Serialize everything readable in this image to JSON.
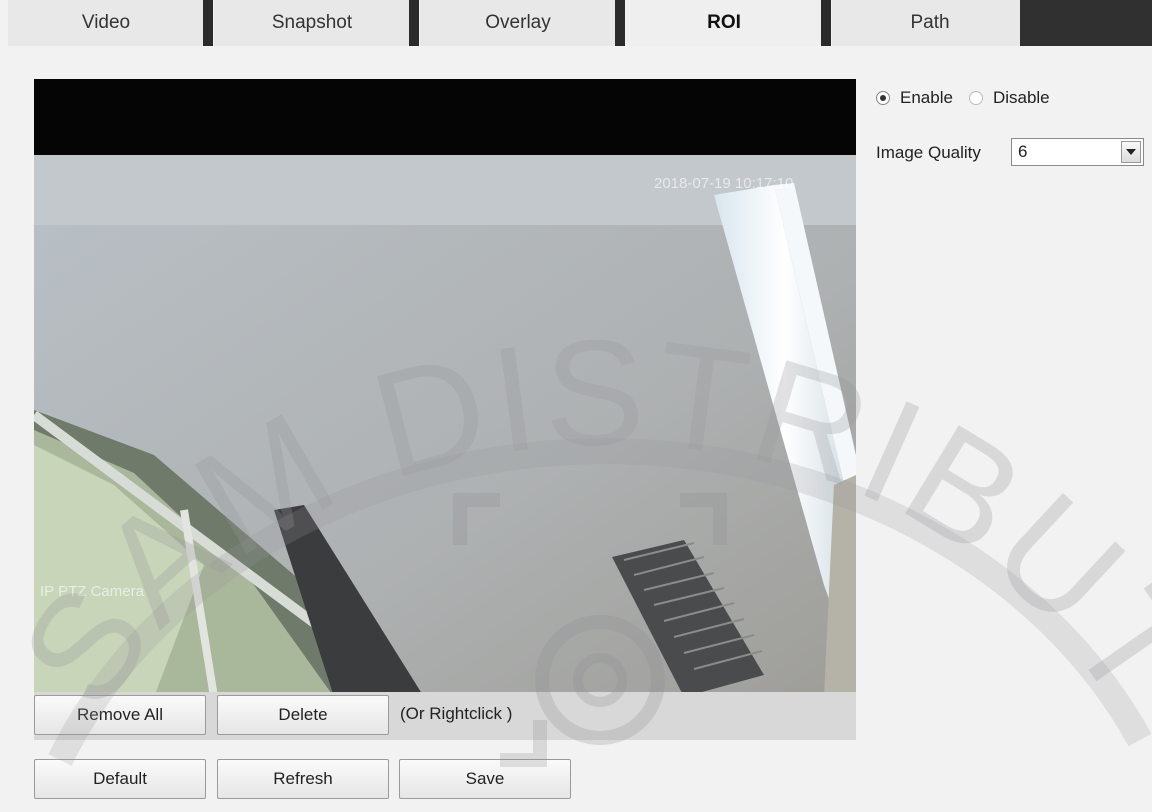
{
  "tabs": [
    {
      "label": "Video"
    },
    {
      "label": "Snapshot"
    },
    {
      "label": "Overlay"
    },
    {
      "label": "ROI"
    },
    {
      "label": "Path"
    }
  ],
  "active_tab": "ROI",
  "video": {
    "timestamp": "2018-07-19 10:17:10",
    "camera_name": "IP PTZ Camera"
  },
  "buttons": {
    "remove_all": "Remove All",
    "delete": "Delete",
    "hint": "(Or Rightclick )",
    "default": "Default",
    "refresh": "Refresh",
    "save": "Save"
  },
  "roi": {
    "enable_label": "Enable",
    "disable_label": "Disable",
    "enabled": true,
    "image_quality_label": "Image Quality",
    "image_quality_value": "6"
  },
  "watermark": {
    "text": "SAM DISTRIBUTION"
  },
  "colors": {
    "page_bg": "#f2f2f2",
    "tab_separator": "#2b2b2b",
    "video_bg": "#050505"
  }
}
